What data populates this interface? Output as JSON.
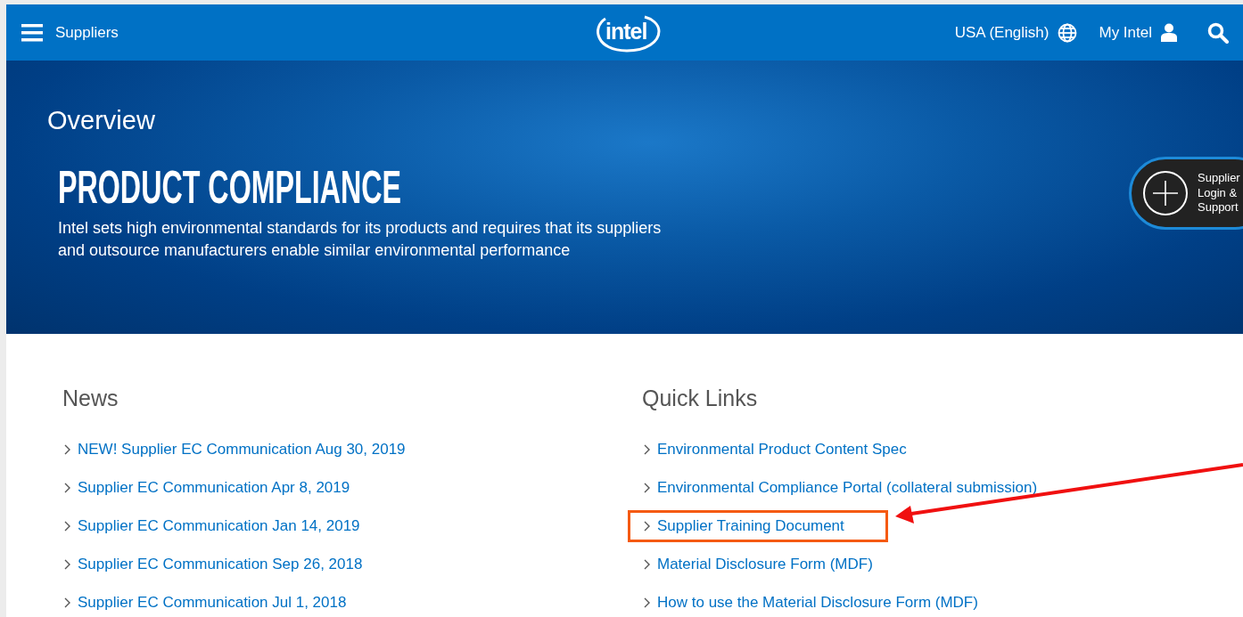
{
  "header": {
    "menu_label": "Suppliers",
    "logo": "intel",
    "region": "USA (English)",
    "account": "My Intel"
  },
  "hero": {
    "eyebrow": "Overview",
    "title": "PRODUCT COMPLIANCE",
    "description": "Intel sets high environmental standards for its products and requires that its suppliers and outsource manufacturers enable similar environmental performance"
  },
  "floating_button": {
    "lines": [
      "Supplier",
      "Login &",
      "Support"
    ]
  },
  "news": {
    "heading": "News",
    "items": [
      {
        "label": "NEW! Supplier EC Communication Aug 30, 2019",
        "highlighted": false
      },
      {
        "label": "Supplier EC Communication Apr 8, 2019",
        "highlighted": false
      },
      {
        "label": "Supplier EC Communication Jan 14, 2019",
        "highlighted": false
      },
      {
        "label": "Supplier EC Communication Sep 26, 2018",
        "highlighted": false
      },
      {
        "label": "Supplier EC Communication Jul 1, 2018",
        "highlighted": false
      }
    ]
  },
  "quick_links": {
    "heading": "Quick Links",
    "items": [
      {
        "label": "Environmental Product Content Spec",
        "highlighted": false
      },
      {
        "label": "Environmental Compliance Portal (collateral submission)",
        "highlighted": false
      },
      {
        "label": "Supplier Training Document",
        "highlighted": true
      },
      {
        "label": "Material Disclosure Form (MDF)",
        "highlighted": false
      },
      {
        "label": "How to use the Material Disclosure Form (MDF)",
        "highlighted": false
      }
    ]
  }
}
